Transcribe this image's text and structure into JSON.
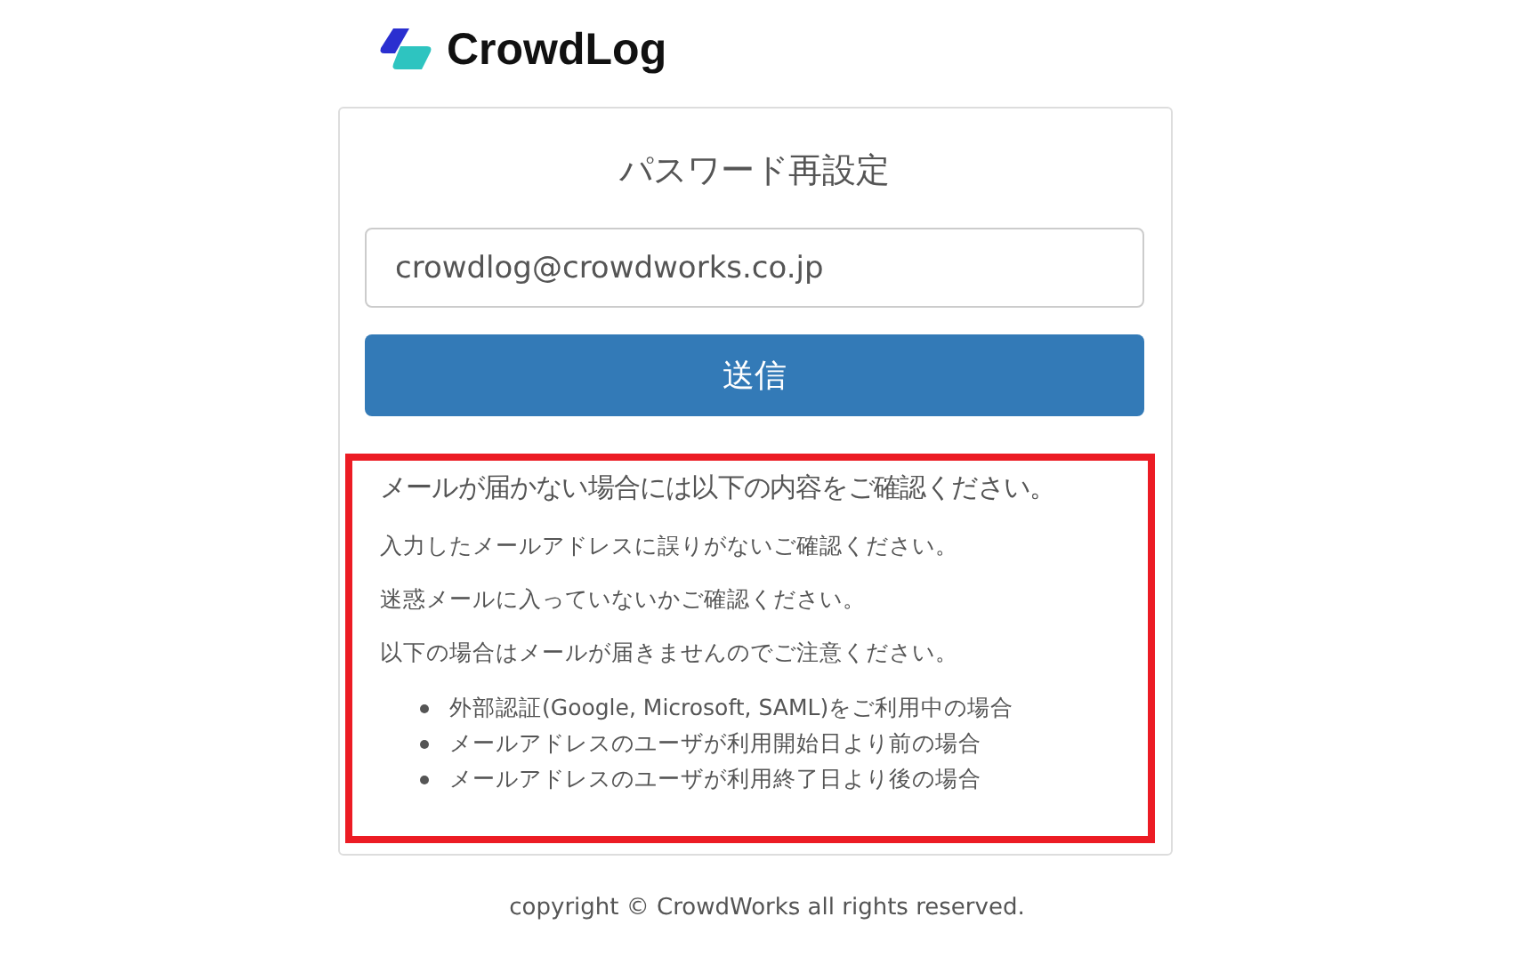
{
  "logo": {
    "text": "CrowdLog"
  },
  "card": {
    "title": "パスワード再設定",
    "email": {
      "value": "crowdlog@crowdworks.co.jp"
    },
    "submit": "送信"
  },
  "notice": {
    "heading": "メールが届かない場合には以下の内容をご確認ください。",
    "paragraphs": [
      "入力したメールアドレスに誤りがないご確認ください。",
      "迷惑メールに入っていないかご確認ください。",
      "以下の場合はメールが届きませんのでご注意ください。"
    ],
    "bullets": [
      "外部認証(Google, Microsoft, SAML)をご利用中の場合",
      "メールアドレスのユーザが利用開始日より前の場合",
      "メールアドレスのユーザが利用終了日より後の場合"
    ]
  },
  "footer": "copyright © CrowdWorks all rights reserved."
}
